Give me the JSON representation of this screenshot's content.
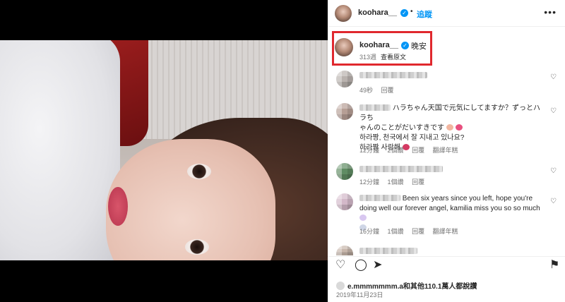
{
  "post": {
    "username": "koohara__",
    "follow_label": "追蹤",
    "more_label": "•••",
    "dot": "•"
  },
  "caption": {
    "username": "koohara__",
    "text": "晚安",
    "time": "313週",
    "translate_label": "查看原文"
  },
  "comments": [
    {
      "text": "",
      "time": "49秒",
      "reply": "回覆",
      "likes": "",
      "translate": ""
    },
    {
      "text_line1": "ハラちゃん天国で元気にしてますか？ずっとハラち",
      "text_line2": "ゃんのことがだいすきです",
      "text_line3": "하라짱, 천국에서 잘 지내고 있나요?",
      "text_line4": "하라짱 사랑해",
      "time": "12分鐘",
      "likes": "2個讚",
      "reply": "回覆",
      "translate": "翻譯年糕"
    },
    {
      "text": "",
      "time": "12分鐘",
      "likes": "1個讚",
      "reply": "回覆",
      "translate": ""
    },
    {
      "text_line1": "Been six years since you left, hope you're",
      "text_line2": "doing well our forever angel, kamilia miss you so so much",
      "time": "16分鐘",
      "likes": "1個讚",
      "reply": "回覆",
      "translate": "翻譯年糕"
    }
  ],
  "footer": {
    "likes_user": "e.mmmmmmm.a",
    "likes_rest": "和其他110.1萬人都說讚",
    "date": "2019年11月23日"
  },
  "icons": {
    "heart": "♡",
    "comment": "◯",
    "share": "➤",
    "save": "⚑"
  },
  "colors": {
    "accent": "#0095f6",
    "highlight_border": "#e0282e",
    "muted": "#737373"
  }
}
